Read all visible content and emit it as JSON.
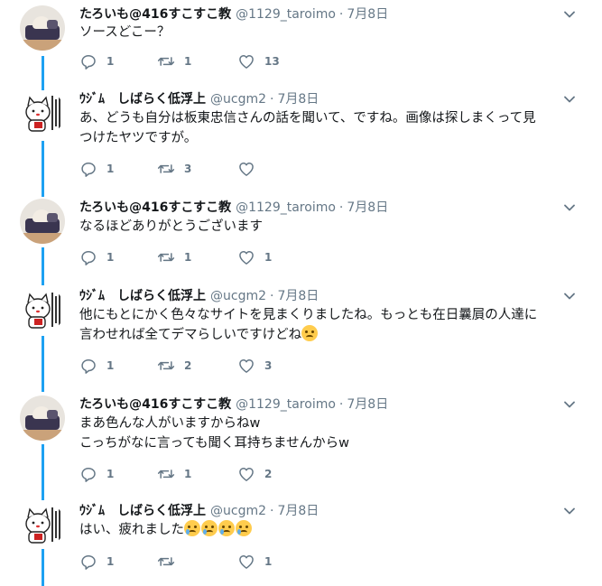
{
  "tweets": [
    {
      "avatar": "taro",
      "name": "たろいも@416すこすこ教",
      "handle": "@1129_taroimo",
      "date": "7月8日",
      "lines": [
        "ソースどこー？"
      ],
      "emojis": [],
      "counts": {
        "reply": "1",
        "retweet": "1",
        "like": "13"
      }
    },
    {
      "avatar": "ucgm",
      "name": "ｳｼﾞﾑ　しばらく低浮上",
      "handle": "@ucgm2",
      "date": "7月8日",
      "lines": [
        "あ、どうも自分は板東忠信さんの話を聞いて、ですね。画像は探しまくって見",
        "つけたヤツですが。"
      ],
      "emojis": [],
      "counts": {
        "reply": "1",
        "retweet": "3",
        "like": ""
      }
    },
    {
      "avatar": "taro",
      "name": "たろいも@416すこすこ教",
      "handle": "@1129_taroimo",
      "date": "7月8日",
      "lines": [
        "なるほどありがとうございます"
      ],
      "emojis": [],
      "counts": {
        "reply": "1",
        "retweet": "1",
        "like": "1"
      }
    },
    {
      "avatar": "ucgm",
      "name": "ｳｼﾞﾑ　しばらく低浮上",
      "handle": "@ucgm2",
      "date": "7月8日",
      "lines": [
        "他にもとにかく色々なサイトを見まくりましたね。もっとも在日曩屓の人達に",
        "言わせれば全てデマらしいですけどね"
      ],
      "emojis": [
        "confounded-face-emoji"
      ],
      "counts": {
        "reply": "1",
        "retweet": "2",
        "like": "3"
      }
    },
    {
      "avatar": "taro",
      "name": "たろいも@416すこすこ教",
      "handle": "@1129_taroimo",
      "date": "7月8日",
      "lines": [
        "まあ色んな人がいますからねw",
        "こっちがなに言っても聞く耳持ちませんからw"
      ],
      "emojis": [],
      "counts": {
        "reply": "1",
        "retweet": "1",
        "like": "2"
      }
    },
    {
      "avatar": "ucgm",
      "name": "ｳｼﾞﾑ　しばらく低浮上",
      "handle": "@ucgm2",
      "date": "7月8日",
      "lines": [
        "はい、疲れました"
      ],
      "emojis": [
        "crying-face-emoji",
        "crying-face-emoji",
        "crying-face-emoji",
        "crying-face-emoji"
      ],
      "counts": {
        "reply": "1",
        "retweet": "",
        "like": "1"
      }
    }
  ],
  "icons": {
    "reply": "reply-icon",
    "retweet": "retweet-icon",
    "like": "heart-icon",
    "caret": "chevron-down-icon"
  },
  "colors": {
    "thread": "#1da1f2",
    "secondary": "#657786",
    "text": "#14171a"
  }
}
